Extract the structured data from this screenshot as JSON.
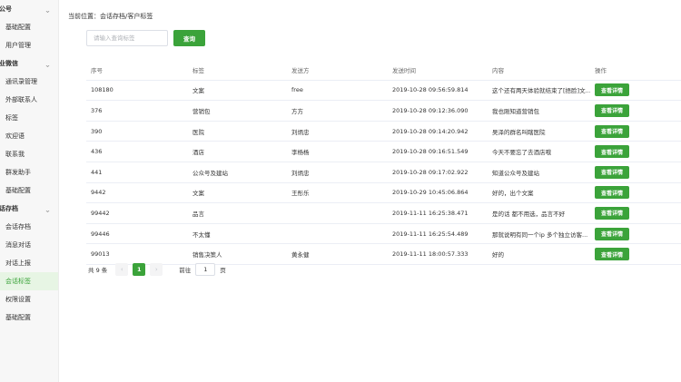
{
  "sidebar": {
    "groups": [
      {
        "label": "众公号",
        "items": [
          "基础配置",
          "用户管理"
        ]
      },
      {
        "label": "企业微信",
        "items": [
          "通讯录管理",
          "外部联系人",
          "标签",
          "欢迎语",
          "联系我",
          "群发助手",
          "基础配置"
        ]
      },
      {
        "label": "会话存档",
        "items": [
          "会话存档",
          "消息对话",
          "对话上报",
          "会话标签",
          "权限设置",
          "基础配置"
        ]
      }
    ],
    "chevron": "^"
  },
  "breadcrumb": "当前位置：会话存档/客户标签",
  "search": {
    "placeholder": "请输入查询标签",
    "value": "",
    "button": "查询"
  },
  "table": {
    "headers": [
      "序号",
      "标签",
      "发送方",
      "发送时间",
      "内容",
      "操作"
    ],
    "action_label": "查看详情",
    "rows": [
      [
        "108180",
        "文案",
        "free",
        "2019-10-28 09:56:59.814",
        "这个还有两天体验就结束了[捂脸]文..."
      ],
      [
        "376",
        "营销包",
        "方方",
        "2019-10-28 09:12:36.090",
        "我也刚知道营销包"
      ],
      [
        "390",
        "医院",
        "刘炳忠",
        "2019-10-28 09:14:20.942",
        "吴泽的群名叫瞎医院"
      ],
      [
        "436",
        "酒店",
        "李杨杨",
        "2019-10-28 09:16:51.549",
        "今天不要忘了去酒店哦"
      ],
      [
        "441",
        "公众号及建站",
        "刘炳忠",
        "2019-10-28 09:17:02.922",
        "知道公众号及建站"
      ],
      [
        "9442",
        "文案",
        "王彤乐",
        "2019-10-29 10:45:06.864",
        "好的，出个文案"
      ],
      [
        "99442",
        "品言",
        "",
        "2019-11-11 16:25:38.471",
        "是的话 都不用选，品言不好"
      ],
      [
        "99446",
        "不太懂",
        "",
        "2019-11-11 16:25:54.489",
        "那就说明有同一个ip 多个独立访客..."
      ],
      [
        "99013",
        "销售决策人",
        "黄永健",
        "2019-11-11 18:00:57.333",
        "好的"
      ]
    ]
  },
  "pagination": {
    "total": "共 9 条",
    "prev": "‹",
    "current": "1",
    "next": "›",
    "goto": "前往",
    "page_value": "1",
    "page_unit": "页"
  },
  "colors": {
    "accent": "#3ba33a",
    "sidebar_bg": "#f7f7f7",
    "active_bg": "#e7f5e4"
  }
}
